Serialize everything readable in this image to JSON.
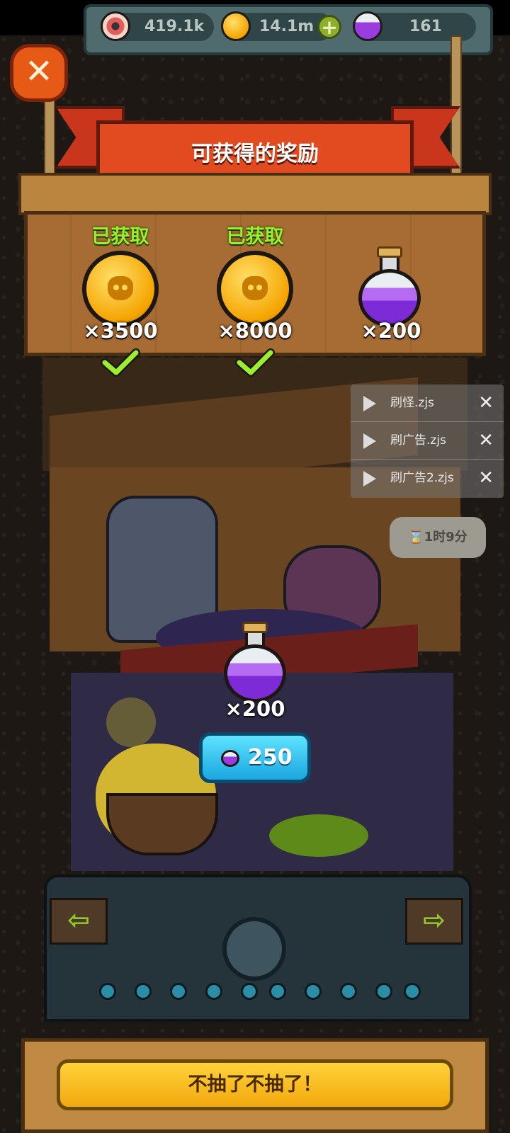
{
  "resources": {
    "eye_value": "419.1k",
    "coin_value": "14.1m",
    "potion_value": "161"
  },
  "header": {
    "title": "可获得的奖励"
  },
  "rewards": [
    {
      "status": "已获取",
      "quantity": "×3500",
      "type": "coin",
      "claimed": true
    },
    {
      "status": "已获取",
      "quantity": "×8000",
      "type": "coin",
      "claimed": true
    },
    {
      "status": "",
      "quantity": "×200",
      "type": "potion",
      "claimed": false
    }
  ],
  "scripts": [
    {
      "name": "刷怪.zjs"
    },
    {
      "name": "刷广告.zjs"
    },
    {
      "name": "刷广告2.zjs"
    }
  ],
  "timer": {
    "text": "⌛1时9分"
  },
  "offer": {
    "quantity": "×200",
    "price": "250"
  },
  "footer": {
    "quit_label": "不抽了不抽了！"
  },
  "icons": {
    "close": "close-icon",
    "eye": "eye-icon",
    "coin": "coin-icon",
    "potion": "potion-icon",
    "plus": "plus-icon",
    "check": "check-icon",
    "play": "play-icon",
    "hourglass": "hourglass-icon"
  },
  "colors": {
    "accent_green": "#9bef2c",
    "ribbon_red": "#e24b20",
    "buy_blue": "#1aa7e0",
    "quit_yellow": "#ffd23a"
  }
}
